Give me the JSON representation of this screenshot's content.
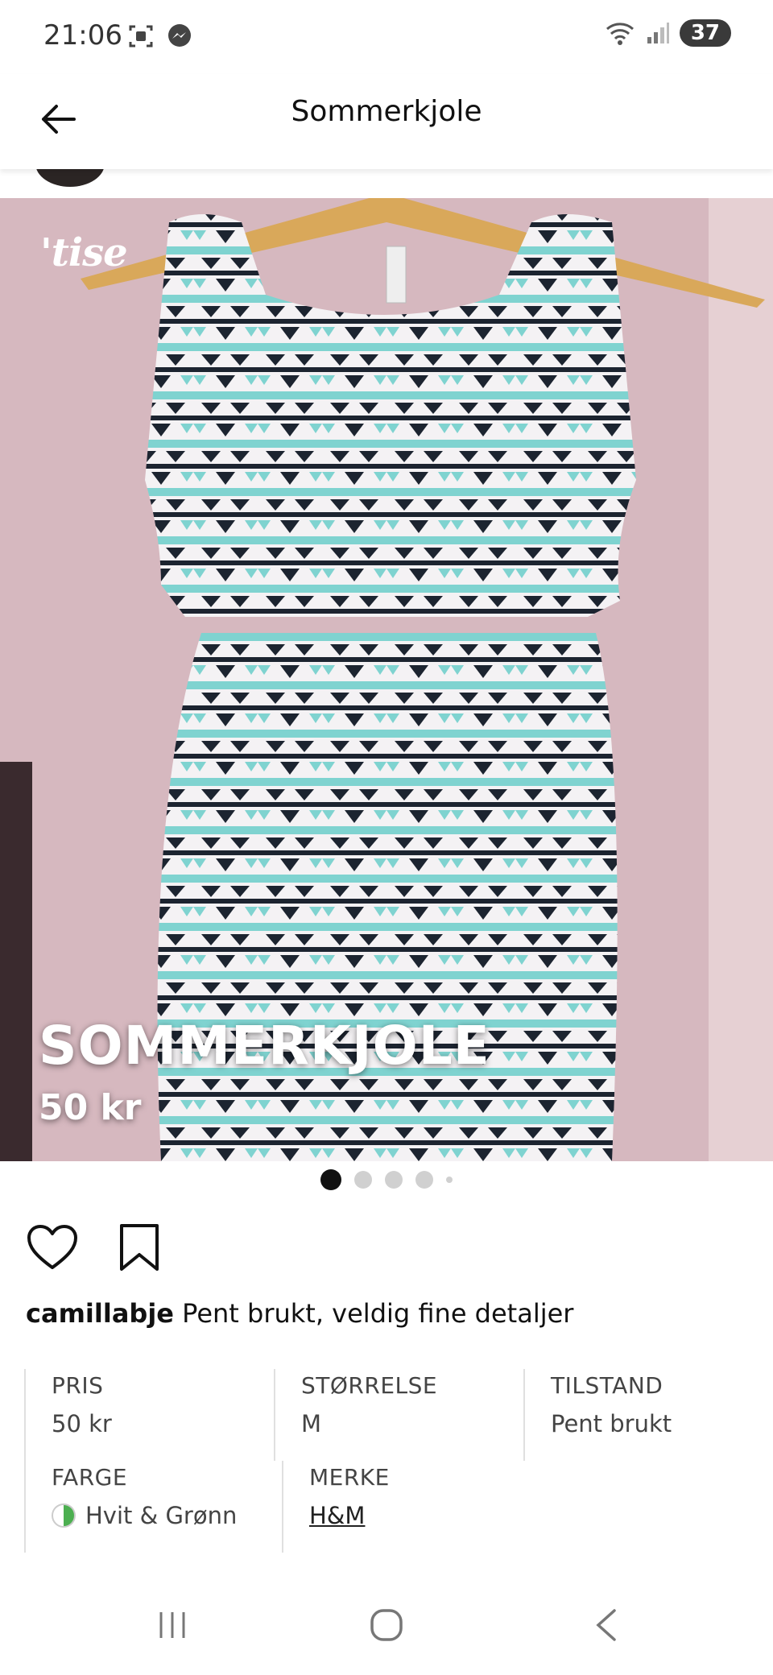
{
  "status_bar": {
    "time": "21:06",
    "battery": "37"
  },
  "header": {
    "title": "Sommerkjole"
  },
  "photo": {
    "watermark": "'tise",
    "overlay_title": "SOMMERKJOLE",
    "overlay_price": "50 kr"
  },
  "carousel": {
    "total_dots": 5,
    "active_index": 0
  },
  "post": {
    "username": "camillabje",
    "description": "Pent brukt, veldig fine detaljer"
  },
  "details": {
    "price": {
      "label": "PRIS",
      "value": "50 kr"
    },
    "size": {
      "label": "STØRRELSE",
      "value": "M"
    },
    "condition": {
      "label": "TILSTAND",
      "value": "Pent brukt"
    },
    "color": {
      "label": "FARGE",
      "value": "Hvit & Grønn"
    },
    "brand": {
      "label": "MERKE",
      "value": "H&M"
    }
  },
  "colors": {
    "accent_swatch_green": "#4caf50",
    "dress_teal": "#7fd3d0",
    "dress_dark": "#1c2430",
    "wall": "#d6b8bf"
  }
}
